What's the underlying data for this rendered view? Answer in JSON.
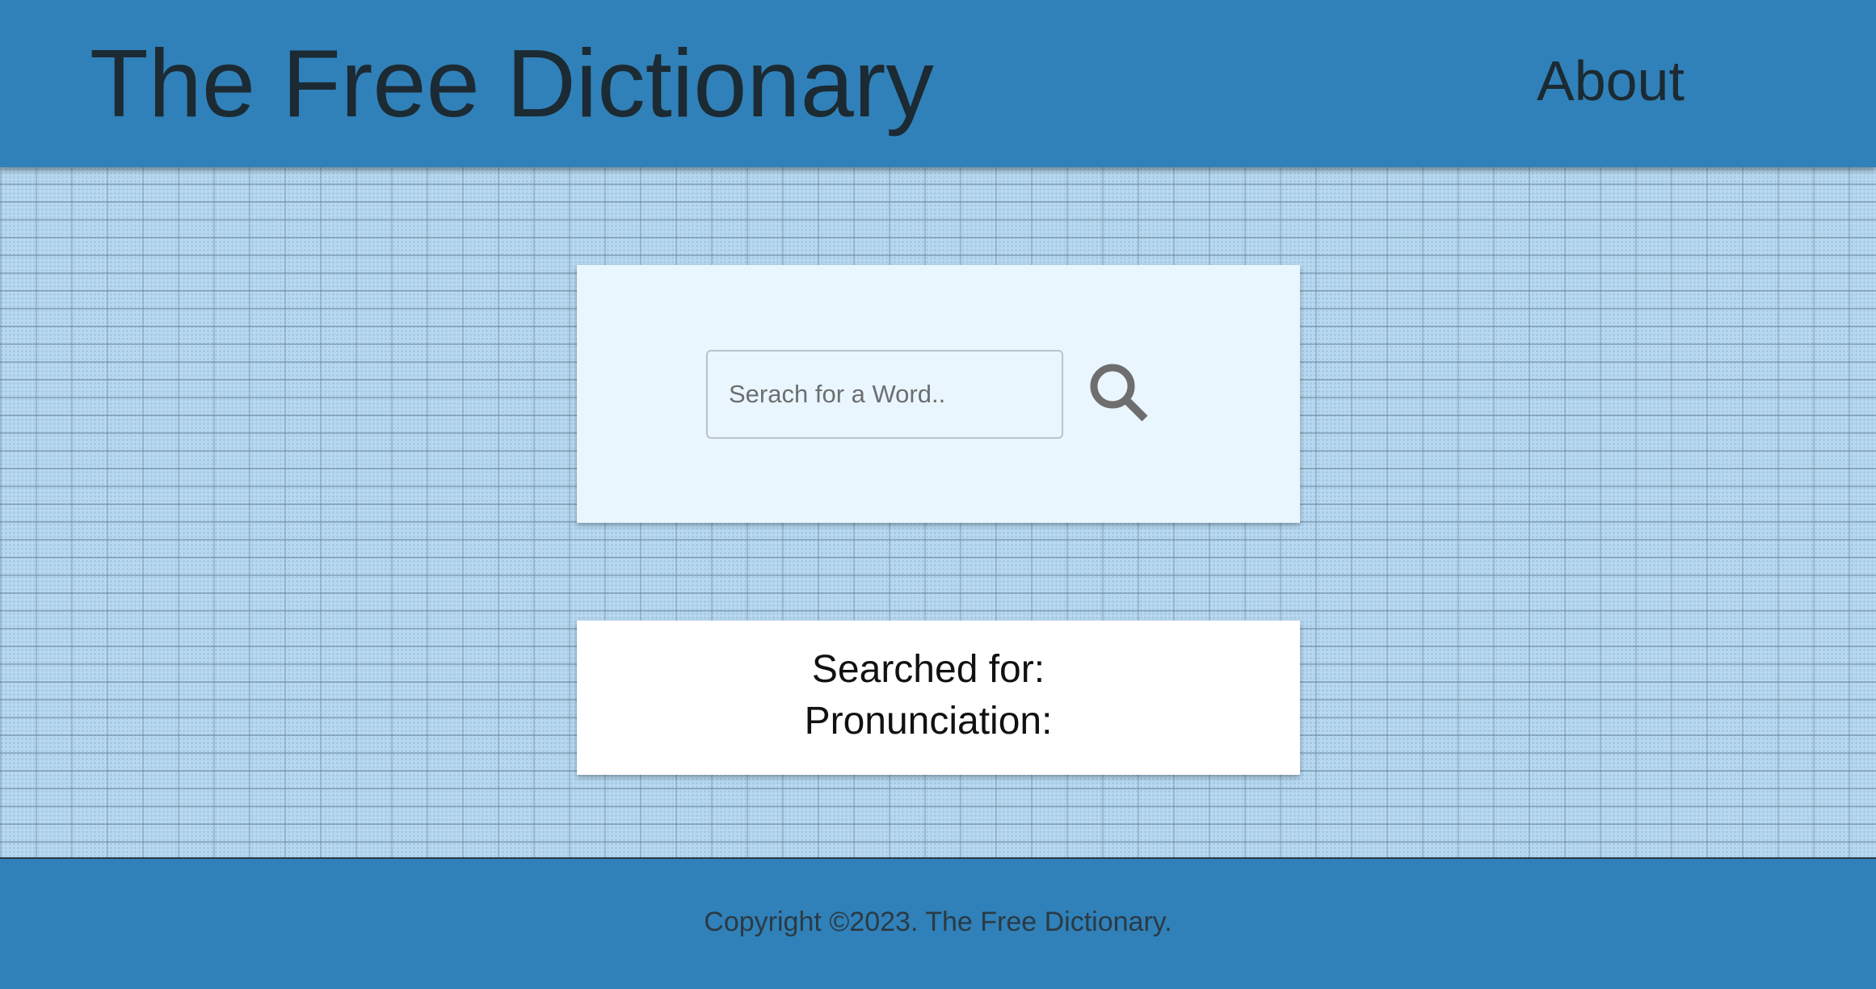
{
  "header": {
    "title": "The Free Dictionary",
    "nav": {
      "about_label": "About"
    }
  },
  "search": {
    "placeholder": "Serach for a Word..",
    "value": "",
    "button_icon": "search-icon"
  },
  "result": {
    "searched_for_label": "Searched for:",
    "pronunciation_label": "Pronunciation:"
  },
  "footer": {
    "copyright": "Copyright ©2023. The Free Dictionary."
  },
  "colors": {
    "header_bg": "#3081b9",
    "page_bg": "#b6d8f0",
    "search_card_bg": "#eaf6fd",
    "result_card_bg": "#ffffff",
    "title_text": "#1c2a33",
    "icon": "#6e6e6e"
  }
}
